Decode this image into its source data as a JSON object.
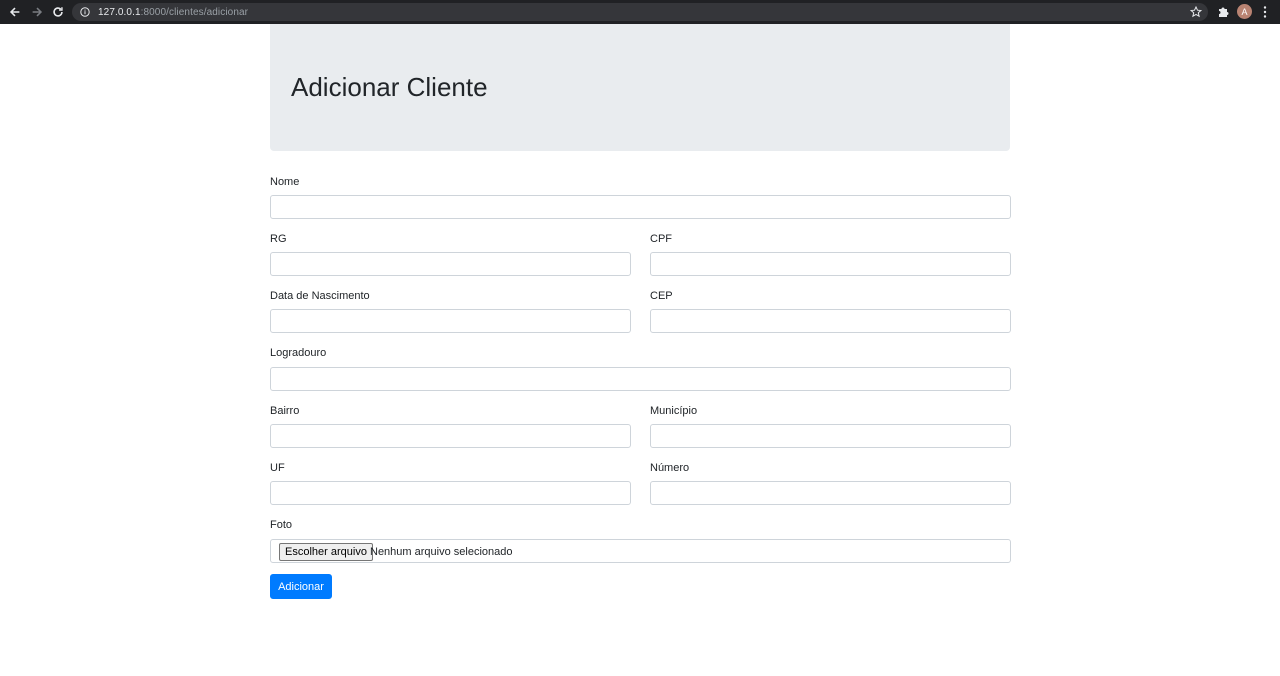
{
  "browser": {
    "url_host": "127.0.0.1",
    "url_rest": ":8000/clientes/adicionar",
    "avatar_initial": "A"
  },
  "header": {
    "title": "Adicionar Cliente"
  },
  "form": {
    "nome_label": "Nome",
    "rg_label": "RG",
    "cpf_label": "CPF",
    "nascimento_label": "Data de Nascimento",
    "cep_label": "CEP",
    "logradouro_label": "Logradouro",
    "bairro_label": "Bairro",
    "municipio_label": "Município",
    "uf_label": "UF",
    "numero_label": "Número",
    "foto_label": "Foto",
    "file_button": "Escolher arquivo",
    "file_status": "Nenhum arquivo selecionado",
    "submit_label": "Adicionar"
  },
  "colors": {
    "primary": "#007bff",
    "jumbotron": "#e9ecef",
    "chrome": "#202124"
  }
}
